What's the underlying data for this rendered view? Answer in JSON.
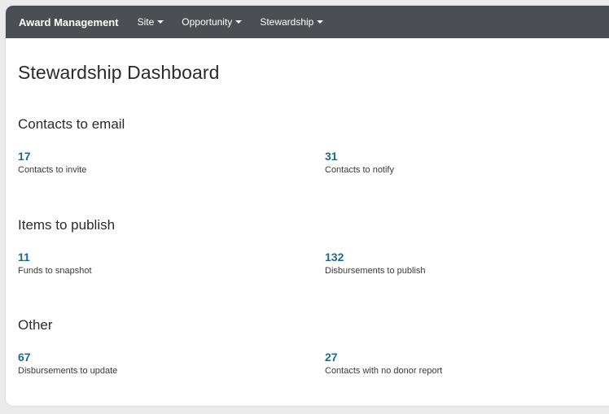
{
  "nav": {
    "brand": "Award Management",
    "items": [
      {
        "label": "Site"
      },
      {
        "label": "Opportunity"
      },
      {
        "label": "Stewardship"
      }
    ]
  },
  "page_title": "Stewardship Dashboard",
  "sections": [
    {
      "title": "Contacts to email",
      "metrics": [
        {
          "value": "17",
          "label": "Contacts to invite"
        },
        {
          "value": "31",
          "label": "Contacts to notify"
        }
      ]
    },
    {
      "title": "Items to publish",
      "metrics": [
        {
          "value": "11",
          "label": "Funds to snapshot"
        },
        {
          "value": "132",
          "label": "Disbursements to publish"
        }
      ]
    },
    {
      "title": "Other",
      "metrics": [
        {
          "value": "67",
          "label": "Disbursements to update"
        },
        {
          "value": "27",
          "label": "Contacts with no donor report"
        }
      ]
    }
  ],
  "colors": {
    "navbar": "#4b4f54",
    "metric_value": "#1b6a8c"
  }
}
